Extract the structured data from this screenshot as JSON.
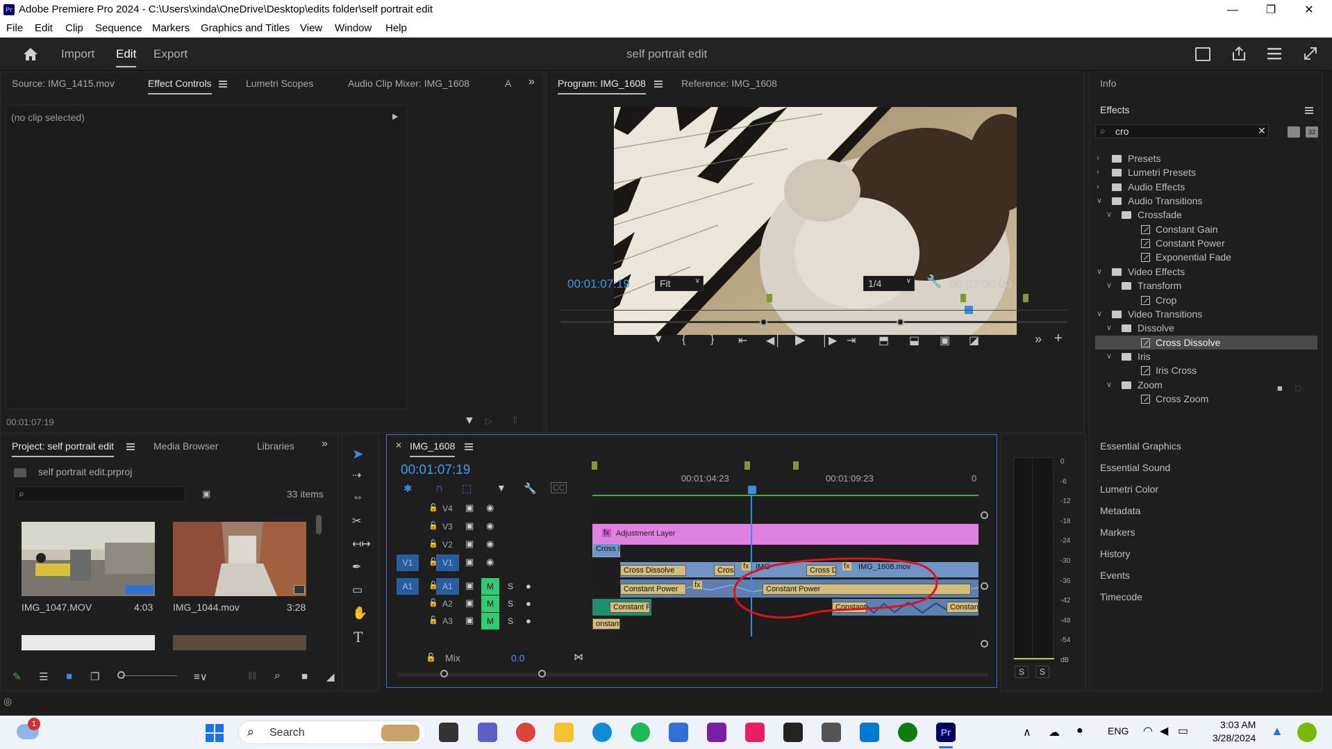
{
  "window": {
    "app_icon": "Pr",
    "title": "Adobe Premiere Pro 2024 - C:\\Users\\xinda\\OneDrive\\Desktop\\edits folder\\self portrait edit"
  },
  "menu": [
    "File",
    "Edit",
    "Clip",
    "Sequence",
    "Markers",
    "Graphics and Titles",
    "View",
    "Window",
    "Help"
  ],
  "nav": {
    "import": "Import",
    "edit": "Edit",
    "export": "Export",
    "project_title": "self portrait edit"
  },
  "source_panel": {
    "tabs": [
      "Source: IMG_1415.mov",
      "Effect Controls",
      "Lumetri Scopes",
      "Audio Clip Mixer: IMG_1608",
      "A"
    ],
    "no_clip": "(no clip selected)",
    "timecode": "00:01:07:19"
  },
  "program_panel": {
    "tabs": [
      "Program: IMG_1608",
      "Reference: IMG_1608"
    ],
    "timecode": "00:01:07:19",
    "fit": "Fit",
    "resolution": "1/4",
    "duration": "00:02:00:00"
  },
  "right_panel": {
    "info": "Info",
    "effects": "Effects",
    "search_value": "cro",
    "tree": [
      {
        "label": "Presets",
        "level": 0,
        "type": "preset",
        "open": false
      },
      {
        "label": "Lumetri Presets",
        "level": 0,
        "type": "preset",
        "open": false
      },
      {
        "label": "Audio Effects",
        "level": 0,
        "type": "folder",
        "open": false
      },
      {
        "label": "Audio Transitions",
        "level": 0,
        "type": "folder",
        "open": true
      },
      {
        "label": "Crossfade",
        "level": 1,
        "type": "folder",
        "open": true
      },
      {
        "label": "Constant Gain",
        "level": 2,
        "type": "fx"
      },
      {
        "label": "Constant Power",
        "level": 2,
        "type": "fx"
      },
      {
        "label": "Exponential Fade",
        "level": 2,
        "type": "fx"
      },
      {
        "label": "Video Effects",
        "level": 0,
        "type": "folder",
        "open": true
      },
      {
        "label": "Transform",
        "level": 1,
        "type": "folder",
        "open": true
      },
      {
        "label": "Crop",
        "level": 2,
        "type": "fx"
      },
      {
        "label": "Video Transitions",
        "level": 0,
        "type": "folder",
        "open": true
      },
      {
        "label": "Dissolve",
        "level": 1,
        "type": "folder",
        "open": true
      },
      {
        "label": "Cross Dissolve",
        "level": 2,
        "type": "fx",
        "selected": true
      },
      {
        "label": "Iris",
        "level": 1,
        "type": "folder",
        "open": true
      },
      {
        "label": "Iris Cross",
        "level": 2,
        "type": "fx"
      },
      {
        "label": "Zoom",
        "level": 1,
        "type": "folder",
        "open": true
      },
      {
        "label": "Cross Zoom",
        "level": 2,
        "type": "fx"
      }
    ],
    "sections": [
      "Essential Graphics",
      "Essential Sound",
      "Lumetri Color",
      "Metadata",
      "Markers",
      "History",
      "Events",
      "Timecode"
    ]
  },
  "project_panel": {
    "tabs": [
      "Project: self portrait edit",
      "Media Browser",
      "Libraries"
    ],
    "file": "self portrait edit.prproj",
    "items_count": "33 items",
    "thumbs": [
      {
        "name": "IMG_1047.MOV",
        "duration": "4:03"
      },
      {
        "name": "IMG_1044.mov",
        "duration": "3:28"
      }
    ]
  },
  "timeline": {
    "tab": "IMG_1608",
    "timecode": "00:01:07:19",
    "ruler": [
      "00:01:04:23",
      "00:01:09:23",
      "0"
    ],
    "tracks_video": [
      "V4",
      "V3",
      "V2",
      "V1"
    ],
    "tracks_audio": [
      "A1",
      "A2",
      "A3"
    ],
    "mix_label": "Mix",
    "mix_value": "0.0",
    "clips": {
      "adjustment": "Adjustment Layer",
      "cross_dissolve": "Cross Dissolve",
      "cross_di": "Cross Di",
      "cross": "Cross",
      "cross_d": "Cross D",
      "img": "IMG",
      "img_mov": "IMG_1608.mov",
      "constant_power": "Constant Power",
      "constant_po": "Constant Po",
      "onstant": "onstant",
      "constan": "Constan",
      "constant": "Constant"
    }
  },
  "meter": {
    "labels": [
      "0",
      "-6",
      "-12",
      "-18",
      "-24",
      "-30",
      "-36",
      "-42",
      "-48",
      "-54",
      "dB"
    ],
    "solo": [
      "S",
      "S"
    ]
  },
  "taskbar": {
    "search": "Search",
    "lang": "ENG",
    "time": "3:03 AM",
    "date": "3/28/2024",
    "badge": "1"
  }
}
